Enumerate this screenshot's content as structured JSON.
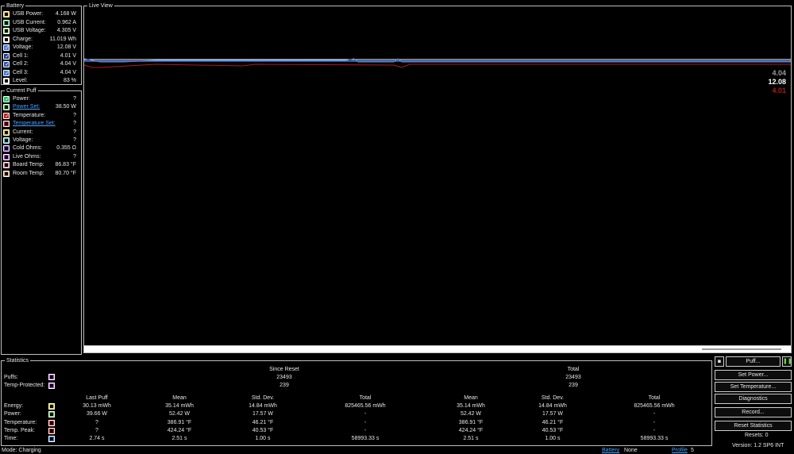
{
  "battery": {
    "title": "Battery",
    "rows": [
      {
        "label": "USB Power:",
        "value": "4.168 W",
        "color": "#f5d000",
        "checked": false
      },
      {
        "label": "USB Current:",
        "value": "0.962 A",
        "color": "#2fbf71",
        "checked": false
      },
      {
        "label": "USB Voltage:",
        "value": "4.305 V",
        "color": "#a6e06a",
        "checked": false
      },
      {
        "label": "Charge:",
        "value": "11.019 Wh",
        "color": "#ffffff",
        "checked": false
      },
      {
        "label": "Voltage:",
        "value": "12.08 V",
        "color": "#3e7be0",
        "checked": true
      },
      {
        "label": "Cell 1:",
        "value": "4.01 V",
        "color": "#1f3a8a",
        "checked": true
      },
      {
        "label": "Cell 2:",
        "value": "4.04 V",
        "color": "#2d55b8",
        "checked": true
      },
      {
        "label": "Cell 3:",
        "value": "4.04 V",
        "color": "#3a79d6",
        "checked": true
      },
      {
        "label": "Level:",
        "value": "83 %",
        "color": "#ffffff",
        "checked": false
      }
    ]
  },
  "puff": {
    "title": "Current Puff",
    "rows": [
      {
        "label": "Power:",
        "value": "?",
        "color": "#1fc25a",
        "checked": true,
        "link": false
      },
      {
        "label": "Power Set:",
        "value": "38.50 W",
        "color": "#5fd35f",
        "checked": false,
        "link": true
      },
      {
        "label": "Temperature:",
        "value": "?",
        "color": "#c51b1b",
        "checked": true,
        "link": false
      },
      {
        "label": "Temperature Set:",
        "value": "?",
        "color": "#d42a2a",
        "checked": false,
        "link": true
      },
      {
        "label": "Current:",
        "value": "?",
        "color": "#e0d000",
        "checked": false,
        "link": false
      },
      {
        "label": "Voltage:",
        "value": "?",
        "color": "#3cc7c7",
        "checked": false,
        "link": false
      },
      {
        "label": "Cold Ohms:",
        "value": "0.355 Ω",
        "color": "#7a2fd0",
        "checked": false,
        "link": false
      },
      {
        "label": "Live Ohms:",
        "value": "?",
        "color": "#b04fd8",
        "checked": false,
        "link": false
      },
      {
        "label": "Board Temp:",
        "value": "86.83 °F",
        "color": "#d8788e",
        "checked": false,
        "link": false
      },
      {
        "label": "Room Temp:",
        "value": "80.70 °F",
        "color": "#e0a070",
        "checked": false,
        "link": false
      }
    ]
  },
  "live_view": {
    "title": "Live View",
    "readouts": [
      {
        "text": "4.04",
        "color": "#9a9a9a"
      },
      {
        "text": "12.08",
        "color": "#ffffff"
      },
      {
        "text": "4.01",
        "color": "#b01818"
      }
    ]
  },
  "chart_data": {
    "type": "line",
    "title": "",
    "series": [
      {
        "name": "",
        "color": "#ffffff",
        "values": [
          12.08,
          12.08,
          12.08,
          12.08,
          12.08,
          12.08
        ]
      },
      {
        "name": "",
        "color": "#3e7be0",
        "values": [
          4.04,
          4.04,
          4.04,
          4.04,
          4.04,
          4.04
        ]
      },
      {
        "name": "",
        "color": "#b01818",
        "values": [
          4.01,
          4.01,
          4.01,
          4.01,
          4.01,
          4.01
        ]
      }
    ]
  },
  "statistics": {
    "title": "Statistics",
    "since_reset": "Since Reset",
    "total": "Total",
    "puffs_label": "Puffs:",
    "temp_protected_label": "Temp-Protected:",
    "puffs_since": "23493",
    "temp_protected_since": "239",
    "puffs_total": "23493",
    "temp_protected_total": "239",
    "col_headers": [
      "Last Puff",
      "Mean",
      "Std. Dev.",
      "Total",
      "Mean",
      "Std. Dev.",
      "Total"
    ],
    "rows": [
      {
        "label": "Energy:",
        "color": "#e0d000",
        "values": [
          "30.13 mWh",
          "35.14 mWh",
          "14.84 mWh",
          "825465.56 mWh",
          "35.14 mWh",
          "14.84 mWh",
          "825465.56 mWh"
        ]
      },
      {
        "label": "Power:",
        "color": "#5fd35f",
        "values": [
          "39.66 W",
          "52.42 W",
          "17.57 W",
          "-",
          "52.42 W",
          "17.57 W",
          "-"
        ]
      },
      {
        "label": "Temperature:",
        "color": "#d42a2a",
        "values": [
          "?",
          "386.91 °F",
          "46.21 °F",
          "-",
          "386.91 °F",
          "46.21 °F",
          "-"
        ]
      },
      {
        "label": "Temp. Peak:",
        "color": "#b01818",
        "values": [
          "?",
          "424.24 °F",
          "40.53 °F",
          "-",
          "424.24 °F",
          "40.53 °F",
          "-"
        ]
      },
      {
        "label": "Time:",
        "color": "#3a79d6",
        "values": [
          "2.74 s",
          "2.51 s",
          "1.00 s",
          "58993.33 s",
          "2.51 s",
          "1.00 s",
          "58993.33 s"
        ]
      }
    ]
  },
  "controls": {
    "puff": "Puff...",
    "set_power": "Set Power...",
    "set_temperature": "Set Temperature...",
    "diagnostics": "Diagnostics",
    "record": "Record...",
    "reset_statistics": "Reset Statistics",
    "resets": "Resets: 0",
    "version": "Version: 1.2 SP6 INT"
  },
  "status": {
    "mode": "Mode: Charging",
    "battery_label": "Battery",
    "battery_value": "None",
    "profile_label": "Profile",
    "profile_value": "5"
  }
}
